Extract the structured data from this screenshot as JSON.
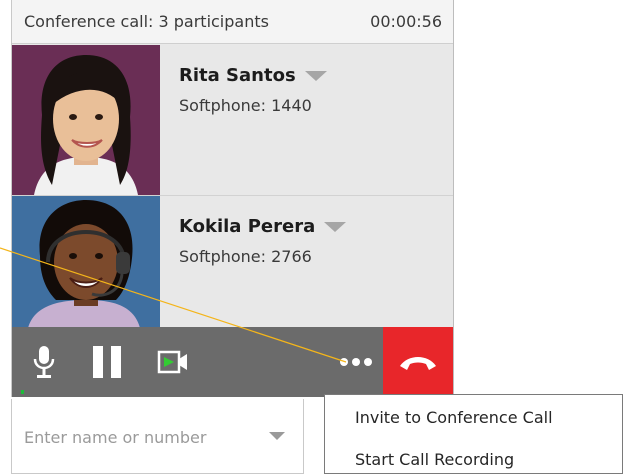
{
  "header": {
    "title": "Conference call: 3 participants",
    "timer": "00:00:56"
  },
  "participants": [
    {
      "name": "Rita Santos",
      "detail": "Softphone: 1440"
    },
    {
      "name": "Kokila Perera",
      "detail": "Softphone: 2766"
    }
  ],
  "controls": {
    "mic_icon": "microphone-icon",
    "pause_icon": "pause-icon",
    "video_icon": "video-icon",
    "more_icon": "more-icon",
    "hangup_icon": "hang-up-icon",
    "hangup_color": "#e8262a",
    "bar_color": "#6b6b6b"
  },
  "search": {
    "placeholder": "Enter name or number"
  },
  "menu": {
    "items": [
      {
        "label": "Invite to Conference Call"
      },
      {
        "label": "Start Call Recording"
      }
    ]
  }
}
